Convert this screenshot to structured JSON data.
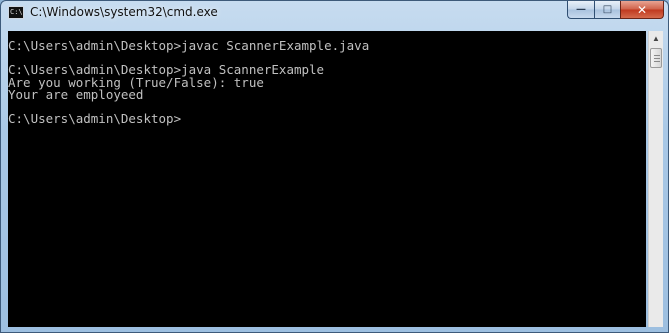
{
  "window": {
    "title": "C:\\Windows\\system32\\cmd.exe",
    "app_icon_text": "C:\\",
    "controls": {
      "minimize": "—",
      "maximize": "□",
      "close": "✕"
    }
  },
  "console": {
    "lines": [
      "",
      "C:\\Users\\admin\\Desktop>javac ScannerExample.java",
      "",
      "C:\\Users\\admin\\Desktop>java ScannerExample",
      "Are you working (True/False): true",
      "Your are employeed",
      "",
      "C:\\Users\\admin\\Desktop>"
    ],
    "text_color": "#c0c0c0",
    "background": "#000000"
  },
  "scrollbar": {
    "up_arrow": "▲"
  }
}
